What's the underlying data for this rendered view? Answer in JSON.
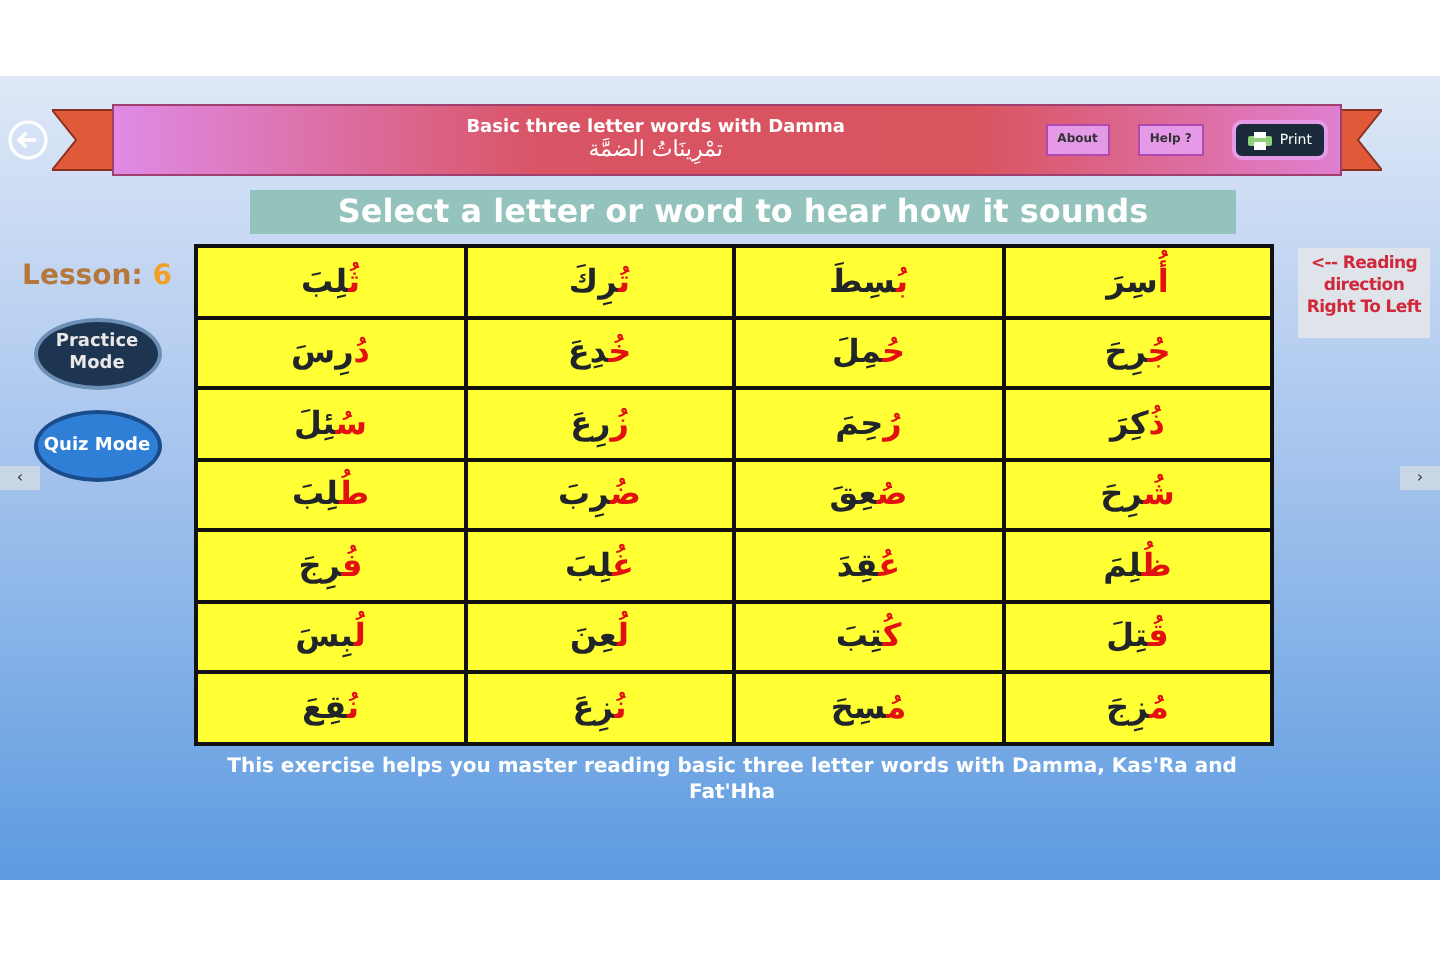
{
  "header": {
    "title": "Basic three letter words with Damma",
    "subtitle": "تمْرِينَاتُ الضمَّة",
    "buttons": [
      {
        "kind": "print",
        "label": "Print"
      },
      {
        "kind": "small",
        "label": "Help ?"
      },
      {
        "kind": "small",
        "label": "About"
      }
    ]
  },
  "instruction": "Select a letter or word to hear how it sounds",
  "lesson": {
    "label": "Lesson:",
    "number": "6"
  },
  "modes": [
    {
      "label": "Practice Mode",
      "selected": true
    },
    {
      "label": "Quiz Mode",
      "selected": false
    }
  ],
  "reading_note": "<-- Reading direction Right To Left",
  "words": [
    [
      {
        "first": "أُ",
        "rest": "سِرَ"
      },
      {
        "first": "بُ",
        "rest": "سِطَ"
      },
      {
        "first": "تُ",
        "rest": "رِكَ"
      },
      {
        "first": "ثُ",
        "rest": "لِبَ"
      }
    ],
    [
      {
        "first": "جُ",
        "rest": "رِحَ"
      },
      {
        "first": "حُ",
        "rest": "مِلَ"
      },
      {
        "first": "خُ",
        "rest": "دِعَ"
      },
      {
        "first": "دُ",
        "rest": "رِسَ"
      }
    ],
    [
      {
        "first": "ذُ",
        "rest": "كِرَ"
      },
      {
        "first": "رُ",
        "rest": "حِمَ"
      },
      {
        "first": "زُ",
        "rest": "رِعَ"
      },
      {
        "first": "سُ",
        "rest": "ئِلَ"
      }
    ],
    [
      {
        "first": "شُ",
        "rest": "رِحَ"
      },
      {
        "first": "صُ",
        "rest": "عِقَ"
      },
      {
        "first": "ضُ",
        "rest": "رِبَ"
      },
      {
        "first": "طُ",
        "rest": "لِبَ"
      }
    ],
    [
      {
        "first": "ظُ",
        "rest": "لِمَ"
      },
      {
        "first": "عُ",
        "rest": "قِدَ"
      },
      {
        "first": "غُ",
        "rest": "لِبَ"
      },
      {
        "first": "فُ",
        "rest": "رِجَ"
      }
    ],
    [
      {
        "first": "قُ",
        "rest": "تِلَ"
      },
      {
        "first": "كُ",
        "rest": "تِبَ"
      },
      {
        "first": "لُ",
        "rest": "عِنَ"
      },
      {
        "first": "لُ",
        "rest": "بِسَ"
      }
    ],
    [
      {
        "first": "مُ",
        "rest": "زِجَ"
      },
      {
        "first": "مُ",
        "rest": "سِحَ"
      },
      {
        "first": "نُ",
        "rest": "زِعَ"
      },
      {
        "first": "نُ",
        "rest": "قِعَ"
      }
    ]
  ],
  "footer": "This exercise helps you master reading basic three letter words with Damma, Kas'Ra and Fat'Hha",
  "scroll_left": "‹",
  "scroll_right": "›"
}
